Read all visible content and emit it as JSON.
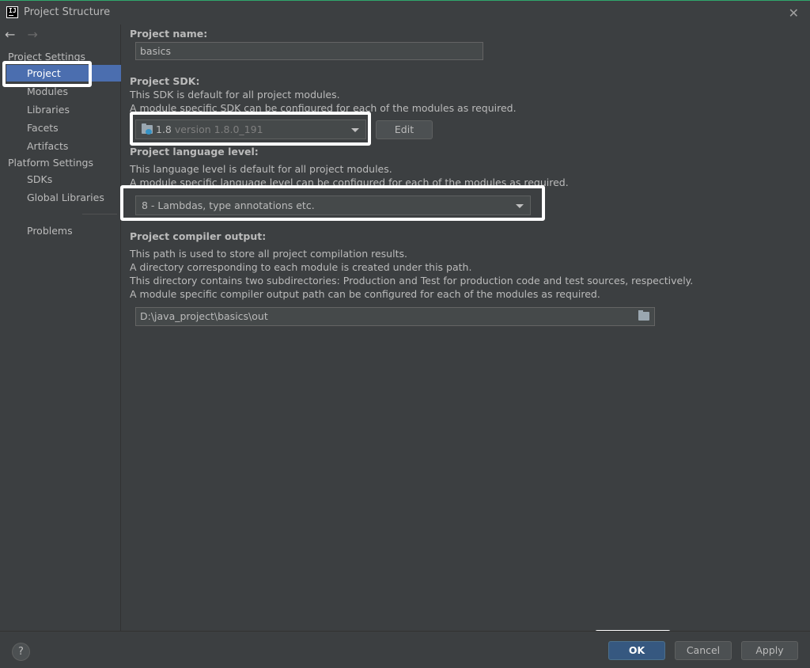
{
  "window": {
    "title": "Project Structure",
    "logo_text": "IJ",
    "close_icon": "close-icon"
  },
  "sidebar": {
    "back_arrow": "←",
    "forward_arrow": "→",
    "project_settings_header": "Project Settings",
    "project_settings_items": [
      {
        "label": "Project",
        "selected": true
      },
      {
        "label": "Modules"
      },
      {
        "label": "Libraries"
      },
      {
        "label": "Facets"
      },
      {
        "label": "Artifacts"
      }
    ],
    "platform_settings_header": "Platform Settings",
    "platform_settings_items": [
      {
        "label": "SDKs"
      },
      {
        "label": "Global Libraries"
      }
    ],
    "problems_label": "Problems"
  },
  "main": {
    "project_name_label": "Project name:",
    "project_name_value": "basics",
    "sdk_label": "Project SDK:",
    "sdk_desc_1": "This SDK is default for all project modules.",
    "sdk_desc_2": "A module specific SDK can be configured for each of the modules as required.",
    "sdk_selected": "1.8",
    "sdk_version": "version 1.8.0_191",
    "edit_button": "Edit",
    "language_level_label": "Project language level:",
    "language_level_desc_1": "This language level is default for all project modules.",
    "language_level_desc_2": "A module specific language level can be configured for each of the modules as required.",
    "language_level_selected": "8 - Lambdas, type annotations etc.",
    "compiler_output_label": "Project compiler output:",
    "compiler_output_desc_1": "This path is used to store all project compilation results.",
    "compiler_output_desc_2": "A directory corresponding to each module is created under this path.",
    "compiler_output_desc_3": "This directory contains two subdirectories: Production and Test for production code and test sources, respectively.",
    "compiler_output_desc_4": "A module specific compiler output path can be configured for each of the modules as required.",
    "compiler_output_path": "D:\\java_project\\basics\\out"
  },
  "footer": {
    "help_label": "?",
    "ok_label": "OK",
    "cancel_label": "Cancel",
    "apply_label": "Apply"
  },
  "colors": {
    "background": "#3c3f41",
    "selection": "#4b6eaf",
    "primary_button": "#365880",
    "text": "#bbbbbb"
  }
}
